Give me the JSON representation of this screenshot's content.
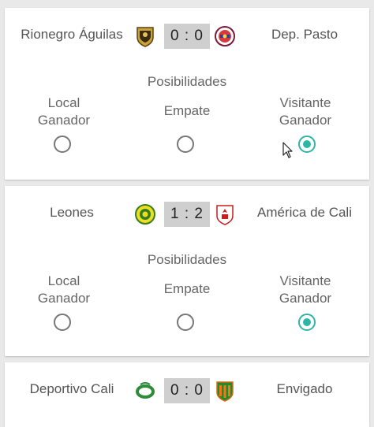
{
  "colors": {
    "accent": "#2fb5a5",
    "score_bg": "#cfcfcf",
    "page_bg": "#e9e9e9"
  },
  "poss_label": "Posibilidades",
  "options": {
    "local_line1": "Local",
    "local_line2": "Ganador",
    "draw": "Empate",
    "visit_line1": "Visitante",
    "visit_line2": "Ganador"
  },
  "matches": [
    {
      "home": "Rionegro Águilas",
      "away": "Dep. Pasto",
      "score": "0 : 0",
      "home_crest": "rionegro-aguilas-crest",
      "away_crest": "deportivo-pasto-crest",
      "selected": "visitante"
    },
    {
      "home": "Leones",
      "away": "América de Cali",
      "score": "1 : 2",
      "home_crest": "leones-crest",
      "away_crest": "america-de-cali-crest",
      "selected": "visitante"
    },
    {
      "home": "Deportivo Cali",
      "away": "Envigado",
      "score": "0 : 0",
      "home_crest": "deportivo-cali-crest",
      "away_crest": "envigado-crest"
    }
  ]
}
